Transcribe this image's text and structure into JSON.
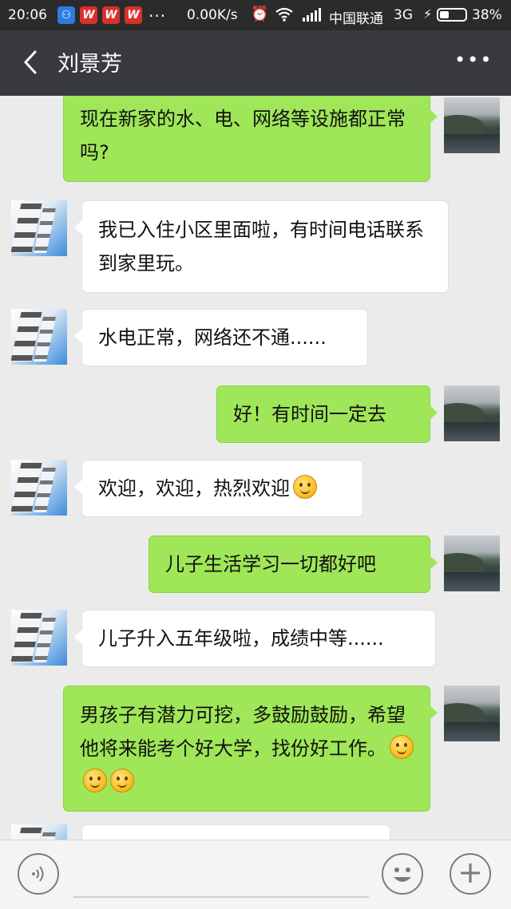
{
  "status_bar": {
    "time": "20:06",
    "app_icons": [
      {
        "icon": "app-blue-icon",
        "glyph": "⚇",
        "color": "#2a7de1"
      },
      {
        "icon": "app-w-icon",
        "glyph": "W",
        "color": "#d9302b"
      },
      {
        "icon": "app-w-icon",
        "glyph": "W",
        "color": "#d9302b"
      },
      {
        "icon": "app-w-icon",
        "glyph": "W",
        "color": "#d9302b"
      }
    ],
    "more_dots": "...",
    "net_speed": "0.00K/s",
    "alarm_icon": "⏰",
    "wifi_icon": "wifi",
    "signal_icon": "signal",
    "carrier": "中国联通",
    "network": "3G",
    "charging_icon": "⚡",
    "battery_percent": "38%",
    "battery_level": 0.38
  },
  "header": {
    "back_icon": "back-chevron",
    "title": "刘景芳",
    "more_icon": "•••"
  },
  "chat": {
    "messages": [
      {
        "sender": "self",
        "text": "现在新家的水、电、网络等设施都正常吗?",
        "emoji_count": 0
      },
      {
        "sender": "other",
        "text": "我已入住小区里面啦，有时间电话联系到家里玩。",
        "emoji_count": 0
      },
      {
        "sender": "other",
        "text": "水电正常，网络还不通......",
        "emoji_count": 0
      },
      {
        "sender": "self",
        "text": "好！有时间一定去",
        "emoji_count": 0
      },
      {
        "sender": "other",
        "text": "欢迎，欢迎，热烈欢迎",
        "emoji_count": 1
      },
      {
        "sender": "self",
        "text": "儿子生活学习一切都好吧",
        "emoji_count": 0
      },
      {
        "sender": "other",
        "text": "儿子升入五年级啦，成绩中等......",
        "emoji_count": 0
      },
      {
        "sender": "self",
        "text": "男孩子有潜力可挖，多鼓励鼓励，希望他将来能考个好大学，找份好工作。",
        "emoji_count": 3
      },
      {
        "sender": "other",
        "text": "",
        "emoji_count": 0
      }
    ]
  },
  "input_bar": {
    "voice_icon": "voice-icon",
    "emoji_icon": "emoji-icon",
    "plus_icon": "+"
  }
}
